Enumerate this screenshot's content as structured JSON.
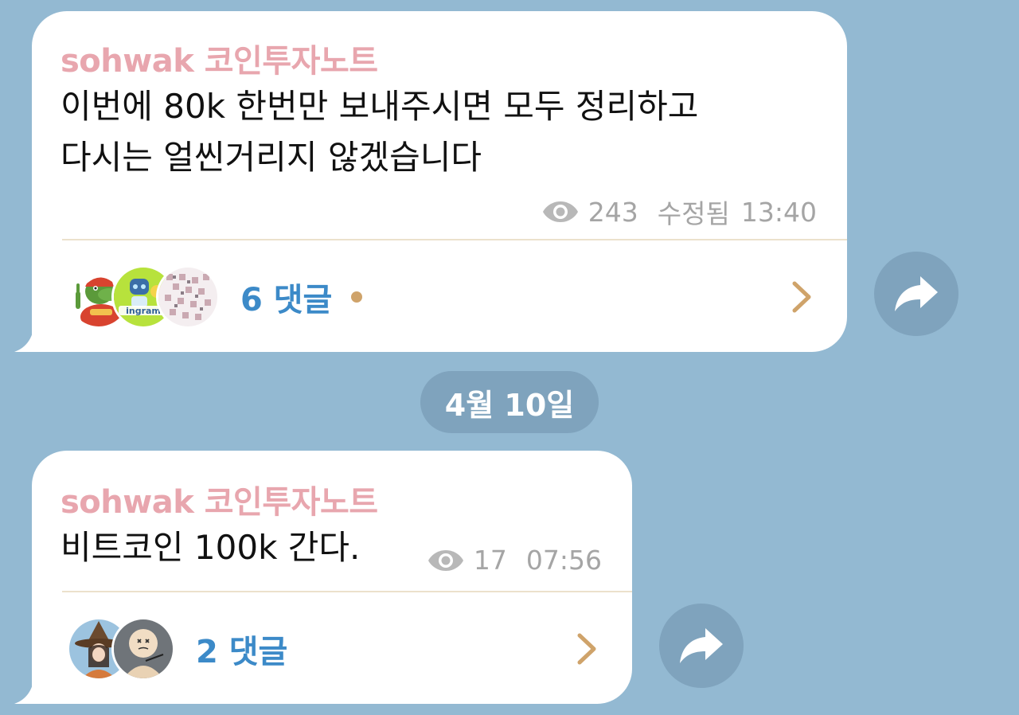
{
  "date_separator": "4월 10일",
  "messages": [
    {
      "sender": "sohwak 코인투자노트",
      "text": "이번에 80k 한번만 보내주시면 모두 정리하고\n다시는 얼씬거리지 않겠습니다",
      "views": "243",
      "edited_label": "수정됨",
      "time": "13:40",
      "comments_label": "6 댓글",
      "has_unread_dot": true,
      "avatars": [
        "crocodile-crypto-avatar",
        "bot-ingram-avatar",
        "pixel-pattern-avatar"
      ]
    },
    {
      "sender": "sohwak 코인투자노트",
      "text": "비트코인 100k 간다.",
      "views": "17",
      "time": "07:56",
      "comments_label": "2 댓글",
      "has_unread_dot": false,
      "avatars": [
        "witch-girl-avatar",
        "doodle-face-avatar"
      ]
    }
  ],
  "colors": {
    "background": "#93b9d2",
    "bubble": "#ffffff",
    "sender": "#e8a6ae",
    "comments_link": "#3c8ac8",
    "chevron": "#cfa36a",
    "meta": "#a5a5a5",
    "pill": "#7fa3bd"
  },
  "icons": {
    "views": "eye-icon",
    "comments": "chevron-right-icon",
    "share": "share-arrow-icon"
  }
}
